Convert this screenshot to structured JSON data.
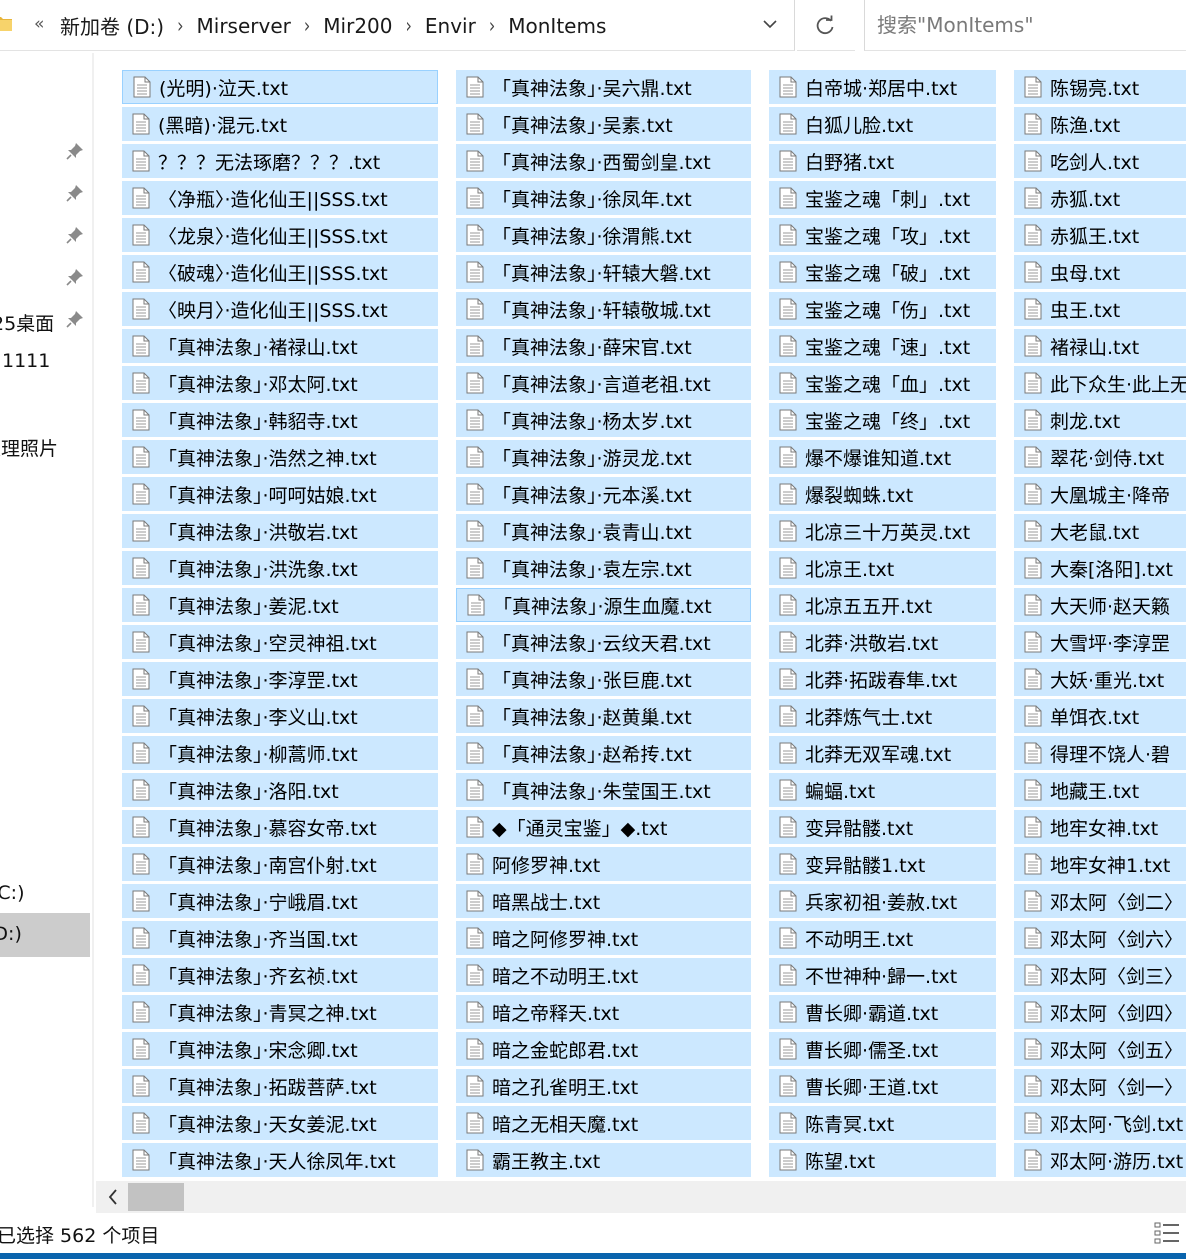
{
  "address": {
    "overflow": "«",
    "crumbs": [
      "新加卷 (D:)",
      "Mirserver",
      "Mir200",
      "Envir",
      "MonItems"
    ]
  },
  "search": {
    "placeholder": "搜索\"MonItems\""
  },
  "nav": {
    "items": [
      {
        "label": "25桌面"
      },
      {
        "label": "1111"
      },
      {
        "label": "处理照片"
      },
      {
        "label": "(C:)"
      },
      {
        "label": "(D:)"
      }
    ]
  },
  "files": {
    "columns": [
      [
        "(光明)·泣天.txt",
        "(黑暗)·混元.txt",
        "？？？无法琢磨？？？.txt",
        "〈净瓶〉·造化仙王||SSS.txt",
        "〈龙泉〉·造化仙王||SSS.txt",
        "〈破魂〉·造化仙王||SSS.txt",
        "〈映月〉·造化仙王||SSS.txt",
        "「真神法象」·褚禄山.txt",
        "「真神法象」·邓太阿.txt",
        "「真神法象」·韩貂寺.txt",
        "「真神法象」·浩然之神.txt",
        "「真神法象」·呵呵姑娘.txt",
        "「真神法象」·洪敬岩.txt",
        "「真神法象」·洪洗象.txt",
        "「真神法象」·姜泥.txt",
        "「真神法象」·空灵神祖.txt",
        "「真神法象」·李淳罡.txt",
        "「真神法象」·李义山.txt",
        "「真神法象」·柳蒿师.txt",
        "「真神法象」·洛阳.txt",
        "「真神法象」·慕容女帝.txt",
        "「真神法象」·南宫仆射.txt",
        "「真神法象」·宁峨眉.txt",
        "「真神法象」·齐当国.txt",
        "「真神法象」·齐玄祯.txt",
        "「真神法象」·青冥之神.txt",
        "「真神法象」·宋念卿.txt",
        "「真神法象」·拓跋菩萨.txt",
        "「真神法象」·天女姜泥.txt",
        "「真神法象」·天人徐凤年.txt"
      ],
      [
        "「真神法象」·吴六鼎.txt",
        "「真神法象」·吴素.txt",
        "「真神法象」·西蜀剑皇.txt",
        "「真神法象」·徐凤年.txt",
        "「真神法象」·徐渭熊.txt",
        "「真神法象」·轩辕大磐.txt",
        "「真神法象」·轩辕敬城.txt",
        "「真神法象」·薛宋官.txt",
        "「真神法象」·言道老祖.txt",
        "「真神法象」·杨太岁.txt",
        "「真神法象」·游灵龙.txt",
        "「真神法象」·元本溪.txt",
        "「真神法象」·袁青山.txt",
        "「真神法象」·袁左宗.txt",
        "「真神法象」·源生血魔.txt",
        "「真神法象」·云纹天君.txt",
        "「真神法象」·张巨鹿.txt",
        "「真神法象」·赵黄巢.txt",
        "「真神法象」·赵希抟.txt",
        "「真神法象」·朱莹国王.txt",
        "◆「通灵宝鉴」◆.txt",
        "阿修罗神.txt",
        "暗黑战士.txt",
        "暗之阿修罗神.txt",
        "暗之不动明王.txt",
        "暗之帝释天.txt",
        "暗之金蛇郎君.txt",
        "暗之孔雀明王.txt",
        "暗之无相天魔.txt",
        "霸王教主.txt"
      ],
      [
        "白帝城·郑居中.txt",
        "白狐儿脸.txt",
        "白野猪.txt",
        "宝鉴之魂「刺」.txt",
        "宝鉴之魂「攻」.txt",
        "宝鉴之魂「破」.txt",
        "宝鉴之魂「伤」.txt",
        "宝鉴之魂「速」.txt",
        "宝鉴之魂「血」.txt",
        "宝鉴之魂「终」.txt",
        "爆不爆谁知道.txt",
        "爆裂蜘蛛.txt",
        "北凉三十万英灵.txt",
        "北凉王.txt",
        "北凉五五开.txt",
        "北莽·洪敬岩.txt",
        "北莽·拓跋春隼.txt",
        "北莽炼气士.txt",
        "北莽无双军魂.txt",
        "蝙蝠.txt",
        "变异骷髅.txt",
        "变异骷髅1.txt",
        "兵家初祖·姜赦.txt",
        "不动明王.txt",
        "不世神种·歸一.txt",
        "曹长卿·霸道.txt",
        "曹长卿·儒圣.txt",
        "曹长卿·王道.txt",
        "陈青冥.txt",
        "陈望.txt"
      ],
      [
        "陈锡亮.txt",
        "陈渔.txt",
        "吃剑人.txt",
        "赤狐.txt",
        "赤狐王.txt",
        "虫母.txt",
        "虫王.txt",
        "褚禄山.txt",
        "此下众生·此上无",
        "刺龙.txt",
        "翠花·剑侍.txt",
        "大凰城主·降帝",
        "大老鼠.txt",
        "大秦[洛阳].txt",
        "大天师·赵天籁",
        "大雪坪·李淳罡",
        "大妖·重光.txt",
        "单饵衣.txt",
        "得理不饶人·碧",
        "地藏王.txt",
        "地牢女神.txt",
        "地牢女神1.txt",
        "邓太阿〈剑二〉",
        "邓太阿〈剑六〉",
        "邓太阿〈剑三〉",
        "邓太阿〈剑四〉",
        "邓太阿〈剑五〉",
        "邓太阿〈剑一〉",
        "邓太阿·飞剑.txt",
        "邓太阿·游历.txt"
      ]
    ]
  },
  "status": {
    "selected_text": "已选择 562 个项目"
  }
}
